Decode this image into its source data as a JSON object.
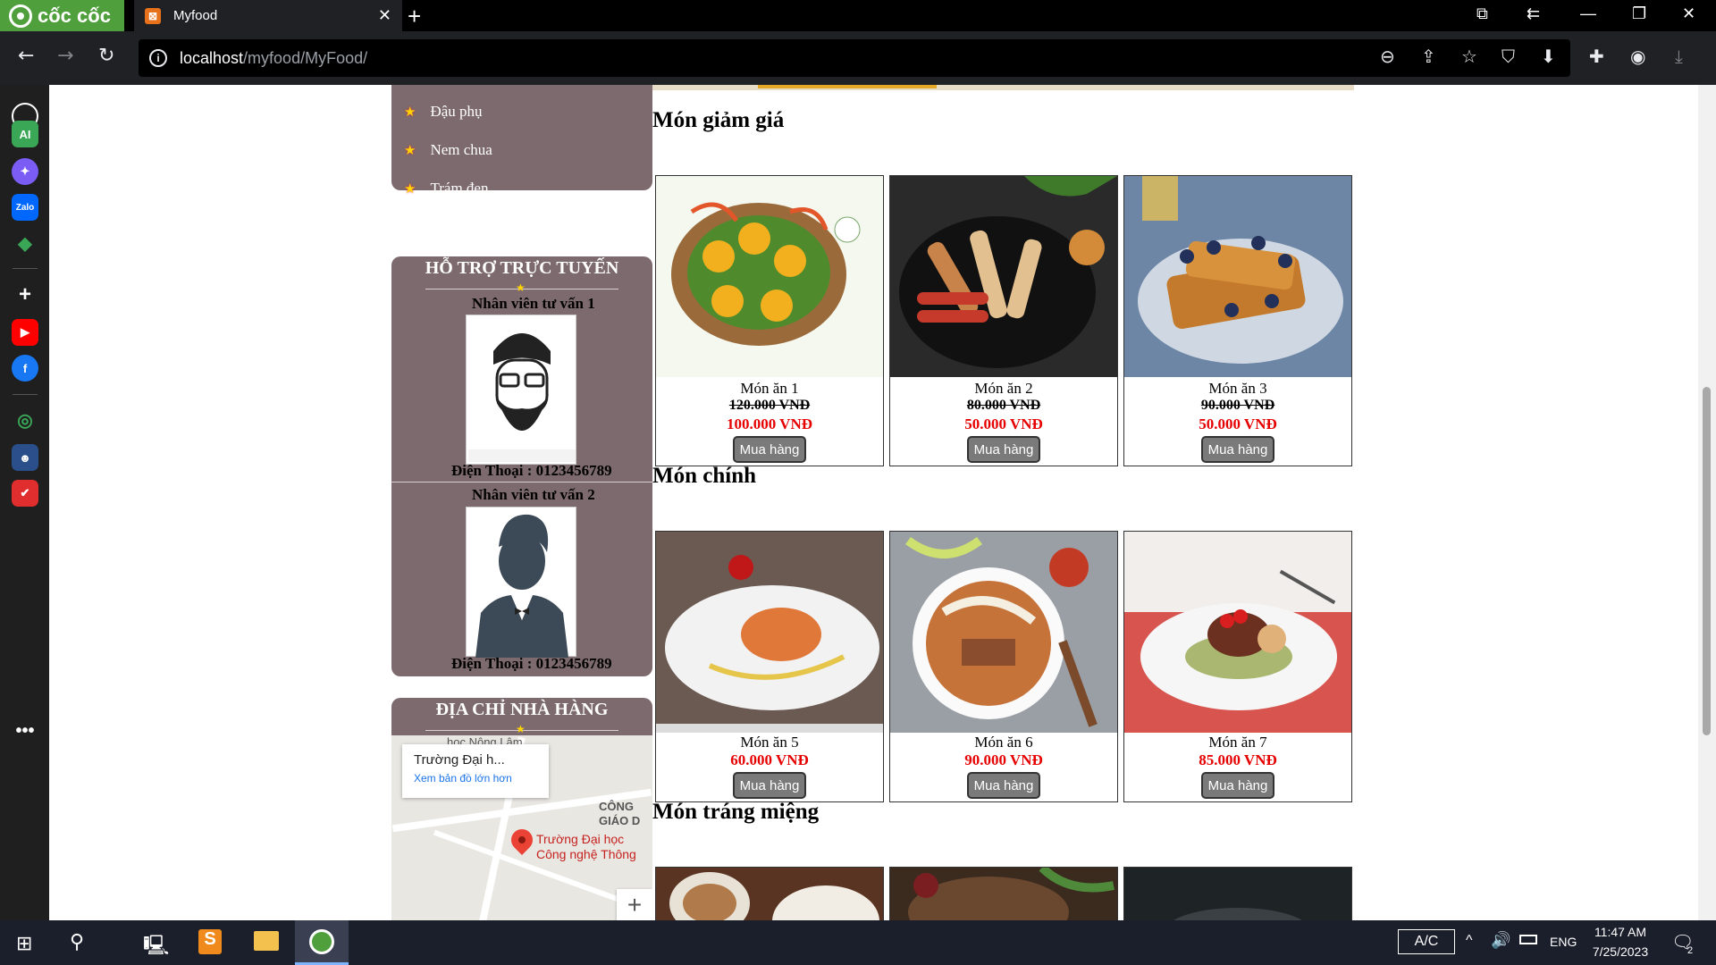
{
  "browser": {
    "brand": "cốc cốc",
    "tab_title": "Myfood",
    "url_host": "localhost",
    "url_path": "/myfood/MyFood/"
  },
  "sidebar_categories": {
    "items": [
      "Đậu phụ",
      "Nem chua",
      "Trám đen"
    ]
  },
  "support": {
    "title": "HỖ TRỢ TRỰC TUYẾN",
    "staff": [
      {
        "name": "Nhân viên tư vấn 1",
        "phone": "Điện Thoại : 0123456789"
      },
      {
        "name": "Nhân viên tư vấn 2",
        "phone": "Điện Thoại : 0123456789"
      }
    ]
  },
  "address": {
    "title": "ĐỊA CHỈ NHÀ HÀNG",
    "map_card_title": "Trường Đại h...",
    "map_card_link": "Xem bản đồ lớn hơn",
    "map_pin_label_1": "Trường Đại học",
    "map_pin_label_2": "Công nghệ Thông",
    "map_text_1": "học Nông Lâm",
    "map_text_2": "CÔNG",
    "map_text_3": "GIÁO D",
    "zoom_label": "+"
  },
  "sections": {
    "discount": {
      "title": "Món giảm giá",
      "items": [
        {
          "name": "Món ăn 1",
          "old_price": "120.000 VNĐ",
          "new_price": "100.000 VNĐ",
          "buy": "Mua hàng"
        },
        {
          "name": "Món ăn 2",
          "old_price": "80.000 VNĐ",
          "new_price": "50.000 VNĐ",
          "buy": "Mua hàng"
        },
        {
          "name": "Món ăn 3",
          "old_price": "90.000 VNĐ",
          "new_price": "50.000 VNĐ",
          "buy": "Mua hàng"
        }
      ]
    },
    "main": {
      "title": "Món chính",
      "items": [
        {
          "name": "Món ăn 5",
          "price": "60.000 VNĐ",
          "buy": "Mua hàng"
        },
        {
          "name": "Món ăn 6",
          "price": "90.000 VNĐ",
          "buy": "Mua hàng"
        },
        {
          "name": "Món ăn 7",
          "price": "85.000 VNĐ",
          "buy": "Mua hàng"
        }
      ]
    },
    "dessert": {
      "title": "Món tráng miệng"
    }
  },
  "taskbar": {
    "ime": "A/C",
    "lang": "ENG",
    "time": "11:47 AM",
    "date": "7/25/2023",
    "notif_count": "2"
  }
}
